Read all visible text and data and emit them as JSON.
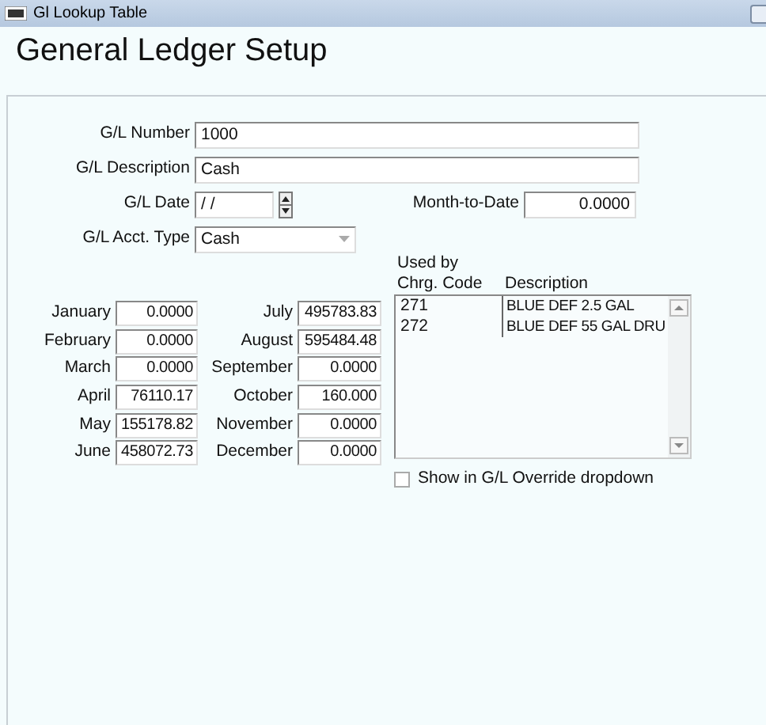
{
  "window": {
    "title": "Gl Lookup Table"
  },
  "heading": "General Ledger Setup",
  "gl_number": {
    "label": "G/L Number",
    "value": "1000"
  },
  "gl_description": {
    "label": "G/L Description",
    "value": "Cash"
  },
  "gl_date": {
    "label": "G/L Date",
    "value": " / /"
  },
  "month_to_date": {
    "label": "Month-to-Date",
    "value": "0.0000"
  },
  "acct_type": {
    "label": "G/L Acct. Type",
    "value": "Cash"
  },
  "months": [
    {
      "label": "January",
      "value": "0.0000"
    },
    {
      "label": "February",
      "value": "0.0000"
    },
    {
      "label": "March",
      "value": "0.0000"
    },
    {
      "label": "April",
      "value": "76110.17"
    },
    {
      "label": "May",
      "value": "155178.82"
    },
    {
      "label": "June",
      "value": "458072.73"
    },
    {
      "label": "July",
      "value": "495783.83"
    },
    {
      "label": "August",
      "value": "595484.48"
    },
    {
      "label": "September",
      "value": "0.0000"
    },
    {
      "label": "October",
      "value": "160.000"
    },
    {
      "label": "November",
      "value": "0.0000"
    },
    {
      "label": "December",
      "value": "0.0000"
    }
  ],
  "used_by": {
    "title": "Used by",
    "columns": [
      "Chrg. Code",
      "Description"
    ],
    "rows": [
      {
        "code": "271",
        "description": "BLUE DEF 2.5 GAL"
      },
      {
        "code": "272",
        "description": "BLUE DEF 55 GAL DRU"
      }
    ]
  },
  "override_checkbox": {
    "label": "Show in G/L Override dropdown",
    "checked": false
  }
}
